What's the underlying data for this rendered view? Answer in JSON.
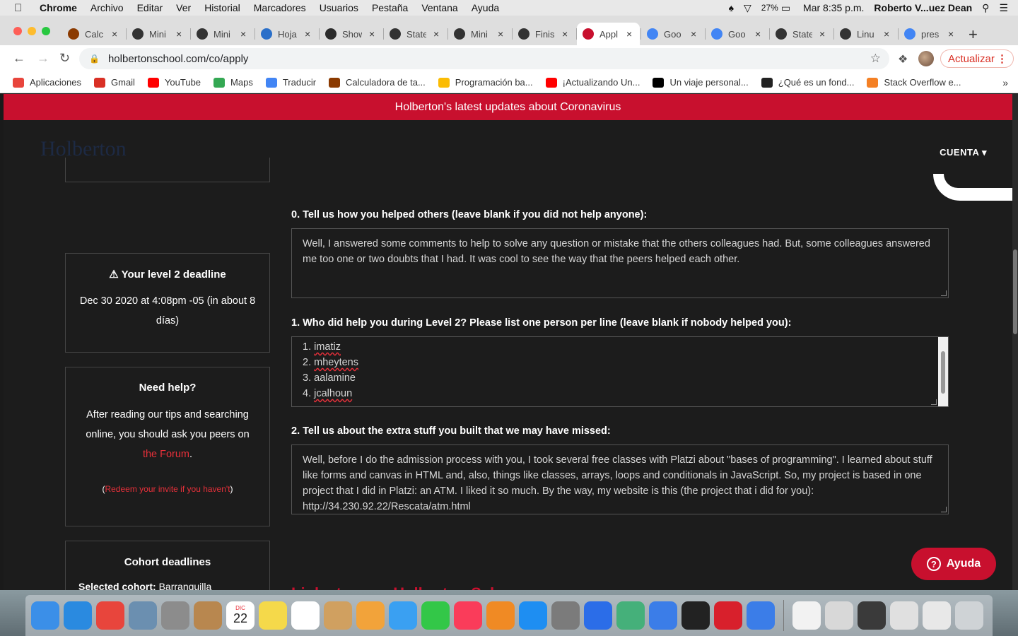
{
  "menubar": {
    "app": "Chrome",
    "items": [
      "Archivo",
      "Editar",
      "Ver",
      "Historial",
      "Marcadores",
      "Usuarios",
      "Pestaña",
      "Ventana",
      "Ayuda"
    ],
    "battery": "27%",
    "clock": "Mar 8:35 p.m.",
    "user": "Roberto V...uez Dean"
  },
  "tabs": [
    {
      "title": "Calc",
      "icon": "fx-icon",
      "color": "#8b3a00"
    },
    {
      "title": "Mini",
      "icon": "github-icon",
      "color": "#333333"
    },
    {
      "title": "Mini",
      "icon": "github-icon",
      "color": "#333333"
    },
    {
      "title": "Hoja",
      "icon": "code-icon",
      "color": "#2a6fc9"
    },
    {
      "title": "Show",
      "icon": "hu-icon",
      "color": "#2b2b2b"
    },
    {
      "title": "State",
      "icon": "github-icon",
      "color": "#333333"
    },
    {
      "title": "Mini",
      "icon": "github-icon",
      "color": "#333333"
    },
    {
      "title": "Finis",
      "icon": "github-icon",
      "color": "#333333"
    },
    {
      "title": "Appl",
      "icon": "holberton-icon",
      "color": "#c8102e"
    },
    {
      "title": "Goo",
      "icon": "translate-icon",
      "color": "#4285f4"
    },
    {
      "title": "Goo",
      "icon": "translate-icon",
      "color": "#4285f4"
    },
    {
      "title": "State",
      "icon": "github-icon",
      "color": "#333333"
    },
    {
      "title": "Linu",
      "icon": "github-icon",
      "color": "#333333"
    },
    {
      "title": "pres",
      "icon": "google-icon",
      "color": "#4285f4"
    }
  ],
  "address": {
    "url": "holbertonschool.com/co/apply",
    "update_label": "Actualizar"
  },
  "bookmarks": [
    {
      "label": "Aplicaciones",
      "icon": "apps-grid-icon",
      "color": "#e8453c"
    },
    {
      "label": "Gmail",
      "icon": "gmail-icon",
      "color": "#d93025"
    },
    {
      "label": "YouTube",
      "icon": "youtube-icon",
      "color": "#ff0000"
    },
    {
      "label": "Maps",
      "icon": "maps-pin-icon",
      "color": "#34a853"
    },
    {
      "label": "Traducir",
      "icon": "translate-icon",
      "color": "#4285f4"
    },
    {
      "label": "Calculadora de ta...",
      "icon": "fx-icon",
      "color": "#8b3a00"
    },
    {
      "label": "Programación ba...",
      "icon": "drive-icon",
      "color": "#fbbc04"
    },
    {
      "label": "¡Actualizando Un...",
      "icon": "youtube-icon",
      "color": "#ff0000"
    },
    {
      "label": "Un viaje personal...",
      "icon": "medium-icon",
      "color": "#000000"
    },
    {
      "label": "¿Qué es un fond...",
      "icon": "bookmark-icon",
      "color": "#222222"
    },
    {
      "label": "Stack Overflow e...",
      "icon": "stackoverflow-icon",
      "color": "#f48024"
    }
  ],
  "page": {
    "banner": "Holberton's latest updates about Coronavirus",
    "logo": "Holberton",
    "account": "CUENTA ▾",
    "deadline_card": {
      "title": "⚠ Your level 2 deadline",
      "body": "Dec 30 2020 at 4:08pm -05 (in about 8 días)"
    },
    "help_card": {
      "title": "Need help?",
      "body": "After reading our tips and searching online, you should ask you peers on",
      "forum_link": "the Forum",
      "period": ".",
      "open_paren": "(",
      "redeem_link": "Redeem your invite if you haven't",
      "close_paren": ")"
    },
    "cohort_card": {
      "title": "Cohort deadlines",
      "selected_label": "Selected cohort:",
      "selected_value": "Barranquilla"
    },
    "questions": [
      {
        "label": "0. Tell us how you helped others (leave blank if you did not help anyone):",
        "answer": "Well, I answered some comments to help to solve any question or mistake that the others colleagues had. But, some colleagues answered me too one or two doubts that I had. It was cool to see the way that the peers helped each other."
      },
      {
        "label": "1. Who did help you during Level 2? Please list one person per line (leave blank if nobody helped you):",
        "people": [
          {
            "num": "1. ",
            "name": "imatiz"
          },
          {
            "num": "2. ",
            "name": "mheytens"
          },
          {
            "num": "3. ",
            "name": "aalamine"
          },
          {
            "num": "4. ",
            "name": "jcalhoun"
          }
        ]
      },
      {
        "label": "2. Tell us about the extra stuff you built that we may have missed:",
        "answer": "Well, before I do the admission process with you, I took several free classes with Platzi about \"bases of programming\". I learned about stuff like forms and canvas in HTML and, also, things like classes, arrays, loops and conditionals in JavaScript. So, my project is based in one project that I did in Platzi: an ATM. I liked it so much. By the way, my website is this (the project that i did for you): http://34.230.92.22/Rescata/atm.html"
      }
    ],
    "next_section": "Links to your Holberton Schoo...",
    "help_button": "Ayuda"
  },
  "dock": [
    {
      "name": "finder-icon",
      "color": "#3b8fe8"
    },
    {
      "name": "safari-icon",
      "color": "#2a8ae0"
    },
    {
      "name": "chrome-icon",
      "color": "#e8453c"
    },
    {
      "name": "preview-icon",
      "color": "#6b8fb0"
    },
    {
      "name": "launchpad-icon",
      "color": "#8c8c8c"
    },
    {
      "name": "contacts-icon",
      "color": "#b8874f"
    },
    {
      "name": "calendar-icon",
      "color": "#ffffff"
    },
    {
      "name": "notes-icon",
      "color": "#f5d94a"
    },
    {
      "name": "reminders-icon",
      "color": "#ffffff"
    },
    {
      "name": "preview-photos-icon",
      "color": "#d0a060"
    },
    {
      "name": "photos-icon",
      "color": "#f2a33a"
    },
    {
      "name": "messages-icon",
      "color": "#3aa0f2"
    },
    {
      "name": "facetime-icon",
      "color": "#33c748"
    },
    {
      "name": "music-icon",
      "color": "#fa3c5a"
    },
    {
      "name": "books-icon",
      "color": "#f08a24"
    },
    {
      "name": "app-store-icon",
      "color": "#1e8ef2"
    },
    {
      "name": "system-preferences-icon",
      "color": "#7b7b7b"
    },
    {
      "name": "keynote-icon",
      "color": "#2b6de8"
    },
    {
      "name": "atom-icon",
      "color": "#45b07a"
    },
    {
      "name": "google-docs-icon",
      "color": "#3b7de8"
    },
    {
      "name": "terminal-icon",
      "color": "#222222"
    },
    {
      "name": "holberton-app-icon",
      "color": "#d8202c"
    },
    {
      "name": "google-docs-icon-2",
      "color": "#3b7de8"
    },
    {
      "name": "document-icon",
      "color": "#f2f2f2"
    },
    {
      "name": "screenshot-icon-1",
      "color": "#d8d8d8"
    },
    {
      "name": "screenshot-icon-2",
      "color": "#3a3a3a"
    },
    {
      "name": "screenshot-icon-3",
      "color": "#e0e0e0"
    },
    {
      "name": "screenshot-icon-4",
      "color": "#e8e8e8"
    },
    {
      "name": "trash-icon",
      "color": "#cfd3d6"
    }
  ],
  "dock_calendar": {
    "month": "DIC",
    "day": "22"
  }
}
